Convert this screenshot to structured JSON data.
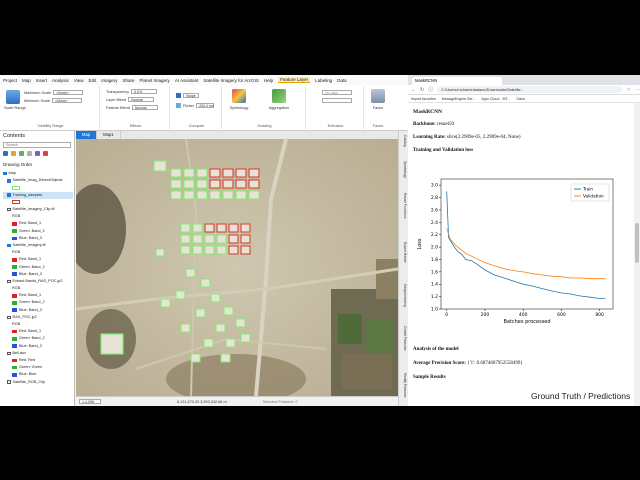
{
  "arcgis": {
    "menu": [
      "Project",
      "Map",
      "Insert",
      "Analysis",
      "View",
      "Edit",
      "Imagery",
      "Share",
      "Planet Imagery",
      "AI Assistant",
      "Satellite Imagery for ArcGIS",
      "Help",
      "Feature Layer",
      "Labeling",
      "Data"
    ],
    "active_menu_index": 12,
    "ribbon": {
      "scale_range_label": "Scale Range",
      "max_scale_label": "Maximum Scale",
      "min_scale_label": "Minimum Scale",
      "max_scale_value": "<None>",
      "min_scale_value": "<None>",
      "visibility_range_caption": "Visibility Range",
      "transparency_label": "Transparency",
      "transparency_value": "0.0%",
      "layer_blend_label": "Layer Blend",
      "layer_blend_value": "Normal",
      "feature_blend_label": "Feature Blend",
      "feature_blend_value": "Normal",
      "effects_caption": "Effects",
      "swipe_label": "Swipe",
      "flicker_label": "Flicker",
      "flicker_value": "200.0 ms",
      "compare_caption": "Compare",
      "symbology_label": "Symbology",
      "aggregation_label": "Aggregation",
      "drawing_caption": "Drawing",
      "no_data_label": "No data",
      "extrusion_caption": "Extrusion",
      "faces_label": "Faces",
      "faces_caption": "Faces"
    },
    "contents": {
      "title": "Contents",
      "search_placeholder": "Search",
      "drawing_order": "Drawing Order",
      "layers": [
        {
          "label": "Map",
          "indent": 0,
          "checked": true,
          "swatch": ""
        },
        {
          "label": "Satellite_Imag_DetectObjects",
          "indent": 1,
          "checked": true,
          "swatch": ""
        },
        {
          "label": "",
          "indent": 2,
          "checked": false,
          "swatch": "#7cf06a"
        },
        {
          "label": "Training_samples",
          "indent": 1,
          "checked": true,
          "swatch": "",
          "selected": true
        },
        {
          "label": "",
          "indent": 2,
          "checked": false,
          "swatch": "#d9362a"
        },
        {
          "label": "Satellite_Imagery_Clip.tif",
          "indent": 1,
          "checked": false,
          "swatch": ""
        },
        {
          "label": "RGB",
          "indent": 2,
          "checked": false,
          "swatch": ""
        },
        {
          "label": "Red: Band_1",
          "indent": 2,
          "checked": false,
          "swatch": "#e02020"
        },
        {
          "label": "Green: Band_2",
          "indent": 2,
          "checked": false,
          "swatch": "#2fae2f"
        },
        {
          "label": "Blue: Band_3",
          "indent": 2,
          "checked": false,
          "swatch": "#2a4fd6"
        },
        {
          "label": "Satellite_Imagery.tif",
          "indent": 1,
          "checked": true,
          "swatch": ""
        },
        {
          "label": "RGB",
          "indent": 2,
          "checked": false,
          "swatch": ""
        },
        {
          "label": "Red: Band_1",
          "indent": 2,
          "checked": false,
          "swatch": "#e02020"
        },
        {
          "label": "Green: Band_2",
          "indent": 2,
          "checked": false,
          "swatch": "#2fae2f"
        },
        {
          "label": "Blue: Band_3",
          "indent": 2,
          "checked": false,
          "swatch": "#2a4fd6"
        },
        {
          "label": "Extract Bands_RAS_POC.jp2",
          "indent": 1,
          "checked": false,
          "swatch": ""
        },
        {
          "label": "RGB",
          "indent": 2,
          "checked": false,
          "swatch": ""
        },
        {
          "label": "Red: Band_1",
          "indent": 2,
          "checked": false,
          "swatch": "#e02020"
        },
        {
          "label": "Green: Band_2",
          "indent": 2,
          "checked": false,
          "swatch": "#2fae2f"
        },
        {
          "label": "Blue: Band_3",
          "indent": 2,
          "checked": false,
          "swatch": "#2a4fd6"
        },
        {
          "label": "RAS_POC.jp2",
          "indent": 1,
          "checked": false,
          "swatch": ""
        },
        {
          "label": "RGB",
          "indent": 2,
          "checked": false,
          "swatch": ""
        },
        {
          "label": "Red: Band_1",
          "indent": 2,
          "checked": false,
          "swatch": "#e02020"
        },
        {
          "label": "Green: Band_2",
          "indent": 2,
          "checked": false,
          "swatch": "#2fae2f"
        },
        {
          "label": "Blue: Band_3",
          "indent": 2,
          "checked": false,
          "swatch": "#2a4fd6"
        },
        {
          "label": "Bell.aux",
          "indent": 1,
          "checked": false,
          "swatch": ""
        },
        {
          "label": "Red: Red",
          "indent": 2,
          "checked": false,
          "swatch": "#e02020"
        },
        {
          "label": "Green: Green",
          "indent": 2,
          "checked": false,
          "swatch": "#2fae2f"
        },
        {
          "label": "Blue: Blue",
          "indent": 2,
          "checked": false,
          "swatch": "#2a4fd6"
        },
        {
          "label": "Satellite_RGB_Clip",
          "indent": 1,
          "checked": false,
          "swatch": ""
        }
      ]
    },
    "map_tabs": [
      "Map",
      "Map1"
    ],
    "active_map_tab": 0,
    "status": {
      "scale": "1:4,096",
      "coords": "6,131,670.20 3,393,342.66 m",
      "selected": "Selected Features: 0"
    },
    "side_panels": [
      "Catalog",
      "Symbology",
      "Raster Functions",
      "Export Raster",
      "Geoprocessing",
      "Create Features",
      "Modify Features",
      "Image Classification"
    ],
    "colors": {
      "detect_outline": "#7cf06a",
      "training_outline": "#d9362a",
      "accent": "#1e78d7"
    }
  },
  "browser": {
    "tab_title": "MaskRCNN",
    "url": "C:/Users/mohamedadaou/Downloads/Satellite...",
    "bookmarks": [
      "Import favorites",
      "ManageEngine Ser...",
      "Agro Cloud - MT...",
      "Odoo"
    ],
    "doc": {
      "heading": "MaskRCNN",
      "backbone_label": "Backbone:",
      "backbone_value": "resnet50",
      "lr_label": "Learning Rate:",
      "lr_value": "slice(2.2909e-05, 2.2909e-04, None)",
      "tv_heading": "Training and Validation loss",
      "analysis": "Analysis of the model",
      "avg_precision_label": "Average Precision Score:",
      "avg_precision_value": "{'1': 0.6874667952558499}",
      "sample_results": "Sample Results",
      "ground_truth": "Ground Truth / Predictions"
    }
  },
  "chart_data": {
    "type": "line",
    "title": "",
    "xlabel": "Batches processed",
    "ylabel": "Loss",
    "xlim": [
      -30,
      870
    ],
    "ylim": [
      1.0,
      3.1
    ],
    "xticks": [
      0,
      200,
      400,
      600,
      800
    ],
    "yticks": [
      1.0,
      1.2,
      1.4,
      1.6,
      1.8,
      2.0,
      2.2,
      2.4,
      2.6,
      2.8,
      3.0
    ],
    "legend": "top-right",
    "series": [
      {
        "name": "Train",
        "color": "#1f77b4",
        "x": [
          0,
          10,
          20,
          40,
          60,
          80,
          100,
          130,
          160,
          200,
          250,
          300,
          350,
          400,
          450,
          500,
          550,
          600,
          650,
          700,
          750,
          800,
          830
        ],
        "y": [
          2.9,
          2.15,
          2.1,
          2.0,
          1.92,
          1.88,
          1.8,
          1.78,
          1.72,
          1.63,
          1.55,
          1.5,
          1.45,
          1.4,
          1.37,
          1.33,
          1.29,
          1.26,
          1.24,
          1.21,
          1.19,
          1.17,
          1.17
        ]
      },
      {
        "name": "Validation",
        "color": "#ff7f0e",
        "x": [
          0,
          20,
          50,
          100,
          150,
          200,
          250,
          300,
          350,
          400,
          450,
          500,
          550,
          600,
          650,
          700,
          750,
          800,
          830
        ],
        "y": [
          2.3,
          2.12,
          2.02,
          1.9,
          1.82,
          1.75,
          1.7,
          1.65,
          1.62,
          1.6,
          1.57,
          1.55,
          1.53,
          1.52,
          1.5,
          1.5,
          1.49,
          1.49,
          1.49
        ]
      }
    ]
  }
}
